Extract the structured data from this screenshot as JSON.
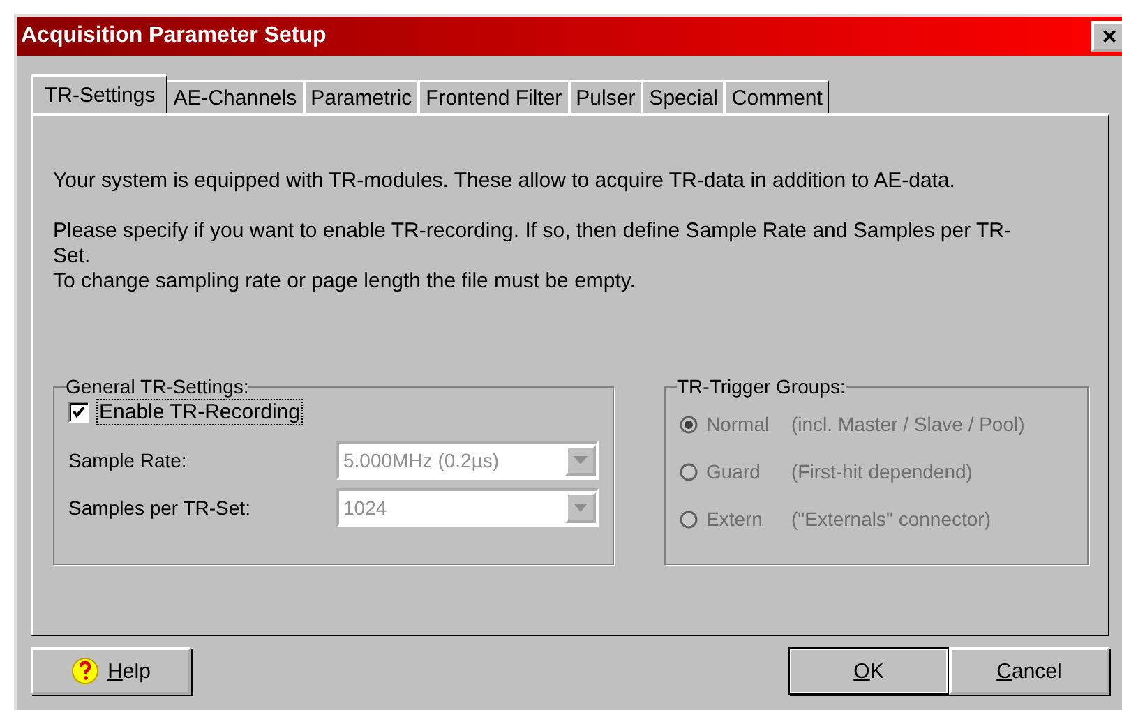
{
  "window": {
    "title": "Acquisition Parameter Setup",
    "close": "×"
  },
  "tabs": [
    {
      "label": "TR-Settings",
      "selected": true
    },
    {
      "label": "AE-Channels",
      "selected": false
    },
    {
      "label": "Parametric",
      "selected": false
    },
    {
      "label": "Frontend Filter",
      "selected": false
    },
    {
      "label": "Pulser",
      "selected": false
    },
    {
      "label": "Special",
      "selected": false
    },
    {
      "label": "Comment",
      "selected": false
    }
  ],
  "paragraphs": [
    [
      "Your system is equipped with TR-modules. These allow to acquire TR-data in addition to AE-data."
    ],
    [
      "Please specify if you want to enable TR-recording. If so, then define Sample Rate and Samples per TR-Set.",
      "To change sampling rate or page length the file must be empty."
    ]
  ],
  "general_group": {
    "title": "General TR-Settings:",
    "checkbox": {
      "label": "Enable TR-Recording",
      "checked": true
    },
    "fields": [
      {
        "label": "Sample Rate:",
        "value": "5.000MHz (0.2µs)",
        "disabled": true
      },
      {
        "label": "Samples per TR-Set:",
        "value": "1024",
        "disabled": true
      }
    ]
  },
  "trigger_group": {
    "title": "TR-Trigger Groups:",
    "options": [
      {
        "name": "Normal",
        "note": "(incl. Master / Slave / Pool)",
        "selected": true,
        "disabled": true
      },
      {
        "name": "Guard",
        "note": "(First-hit dependend)",
        "selected": false,
        "disabled": true
      },
      {
        "name": "Extern",
        "note": "(\"Externals\" connector)",
        "selected": false,
        "disabled": true
      }
    ]
  },
  "buttons": [
    {
      "kind": "help",
      "label": "Help"
    },
    {
      "kind": "ok",
      "label": "OK"
    },
    {
      "kind": "cancel",
      "label": "Cancel"
    }
  ]
}
